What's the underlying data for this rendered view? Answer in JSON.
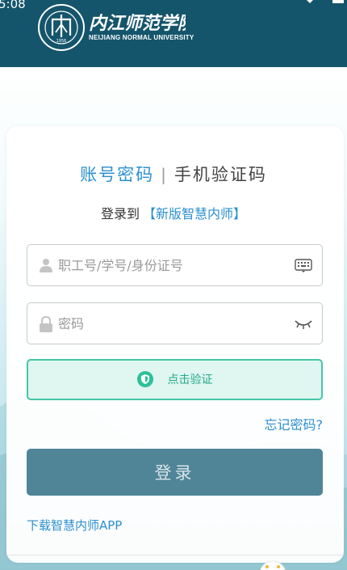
{
  "status_bar": {
    "time": "5:08"
  },
  "header": {
    "logo_seal_year": "1956",
    "university_name_cn": "内江师范学院",
    "university_name_en": "NEIJIANG NORMAL UNIVERSITY"
  },
  "login": {
    "tab_password": "账号密码",
    "tab_separator": "|",
    "tab_sms": "手机验证码",
    "login_to_label": "登录到",
    "system_name": "【新版智慧内师】",
    "account_placeholder": "职工号/学号/身份证号",
    "password_placeholder": "密码",
    "verify_label": "点击验证",
    "forgot_password": "忘记密码?",
    "login_button": "登录",
    "download_app": "下载智慧内师APP"
  },
  "colors": {
    "header_bg": "#15556b",
    "accent_blue": "#2c8fcf",
    "verify_green": "#45c6a8",
    "login_button_bg": "#4f8597"
  },
  "icons": {
    "account": "user-icon",
    "password": "lock-icon",
    "keyboard": "keyboard-icon",
    "visibility": "eye-closed-icon",
    "verify": "shield-check-icon"
  }
}
